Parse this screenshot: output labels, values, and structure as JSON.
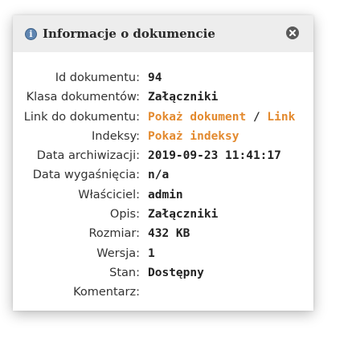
{
  "dialog": {
    "title": "Informacje o dokumencie",
    "info_icon_glyph": "i",
    "icons": {
      "info": "info-icon",
      "close": "close-icon"
    },
    "colors": {
      "link": "#e38a2f",
      "titlebar": "#ededed",
      "info_icon": "#5f85b1"
    }
  },
  "fields": {
    "id": {
      "label": "Id dokumentu:",
      "value": "94"
    },
    "klasa": {
      "label": "Klasa dokumentów:",
      "value": "Załączniki"
    },
    "link": {
      "label": "Link do dokumentu:",
      "show_document": "Pokaż dokument",
      "separator": " / ",
      "link": "Link"
    },
    "indeksy": {
      "label": "Indeksy:",
      "value": "Pokaż indeksy"
    },
    "data_archiwizacji": {
      "label": "Data archiwizacji:",
      "value": "2019-09-23 11:41:17"
    },
    "data_wygasniecia": {
      "label": "Data wygaśnięcia:",
      "value": "n/a"
    },
    "wlasciciel": {
      "label": "Właściciel:",
      "value": "admin"
    },
    "opis": {
      "label": "Opis:",
      "value": "Załączniki"
    },
    "rozmiar": {
      "label": "Rozmiar:",
      "value": "432 KB"
    },
    "wersja": {
      "label": "Wersja:",
      "value": "1"
    },
    "stan": {
      "label": "Stan:",
      "value": "Dostępny"
    },
    "komentarz": {
      "label": "Komentarz:",
      "value": ""
    }
  }
}
